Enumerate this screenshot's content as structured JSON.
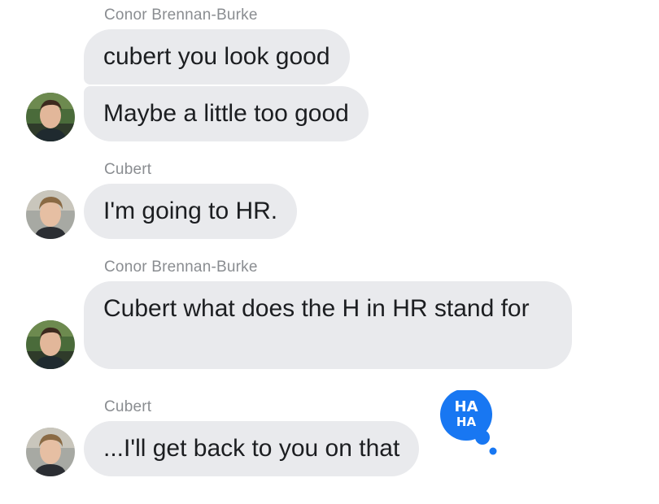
{
  "conversation": {
    "groups": [
      {
        "sender": "Conor Brennan-Burke",
        "messages": [
          "cubert you look good",
          "Maybe a little too good"
        ]
      },
      {
        "sender": "Cubert",
        "messages": [
          "I'm going to HR."
        ]
      },
      {
        "sender": "Conor Brennan-Burke",
        "messages": [
          "Cubert what does the H in HR stand for"
        ]
      },
      {
        "sender": "Cubert",
        "messages": [
          "...I'll get back to you on that"
        ],
        "reaction": {
          "icon": "haha-reaction-icon",
          "text_line1": "HA",
          "text_line2": "HA",
          "color": "#1877f2"
        }
      }
    ]
  },
  "colors": {
    "bubble": "#e9eaed",
    "sender_text": "#8a8d91",
    "message_text": "#1c1e21",
    "reaction": "#1877f2"
  }
}
